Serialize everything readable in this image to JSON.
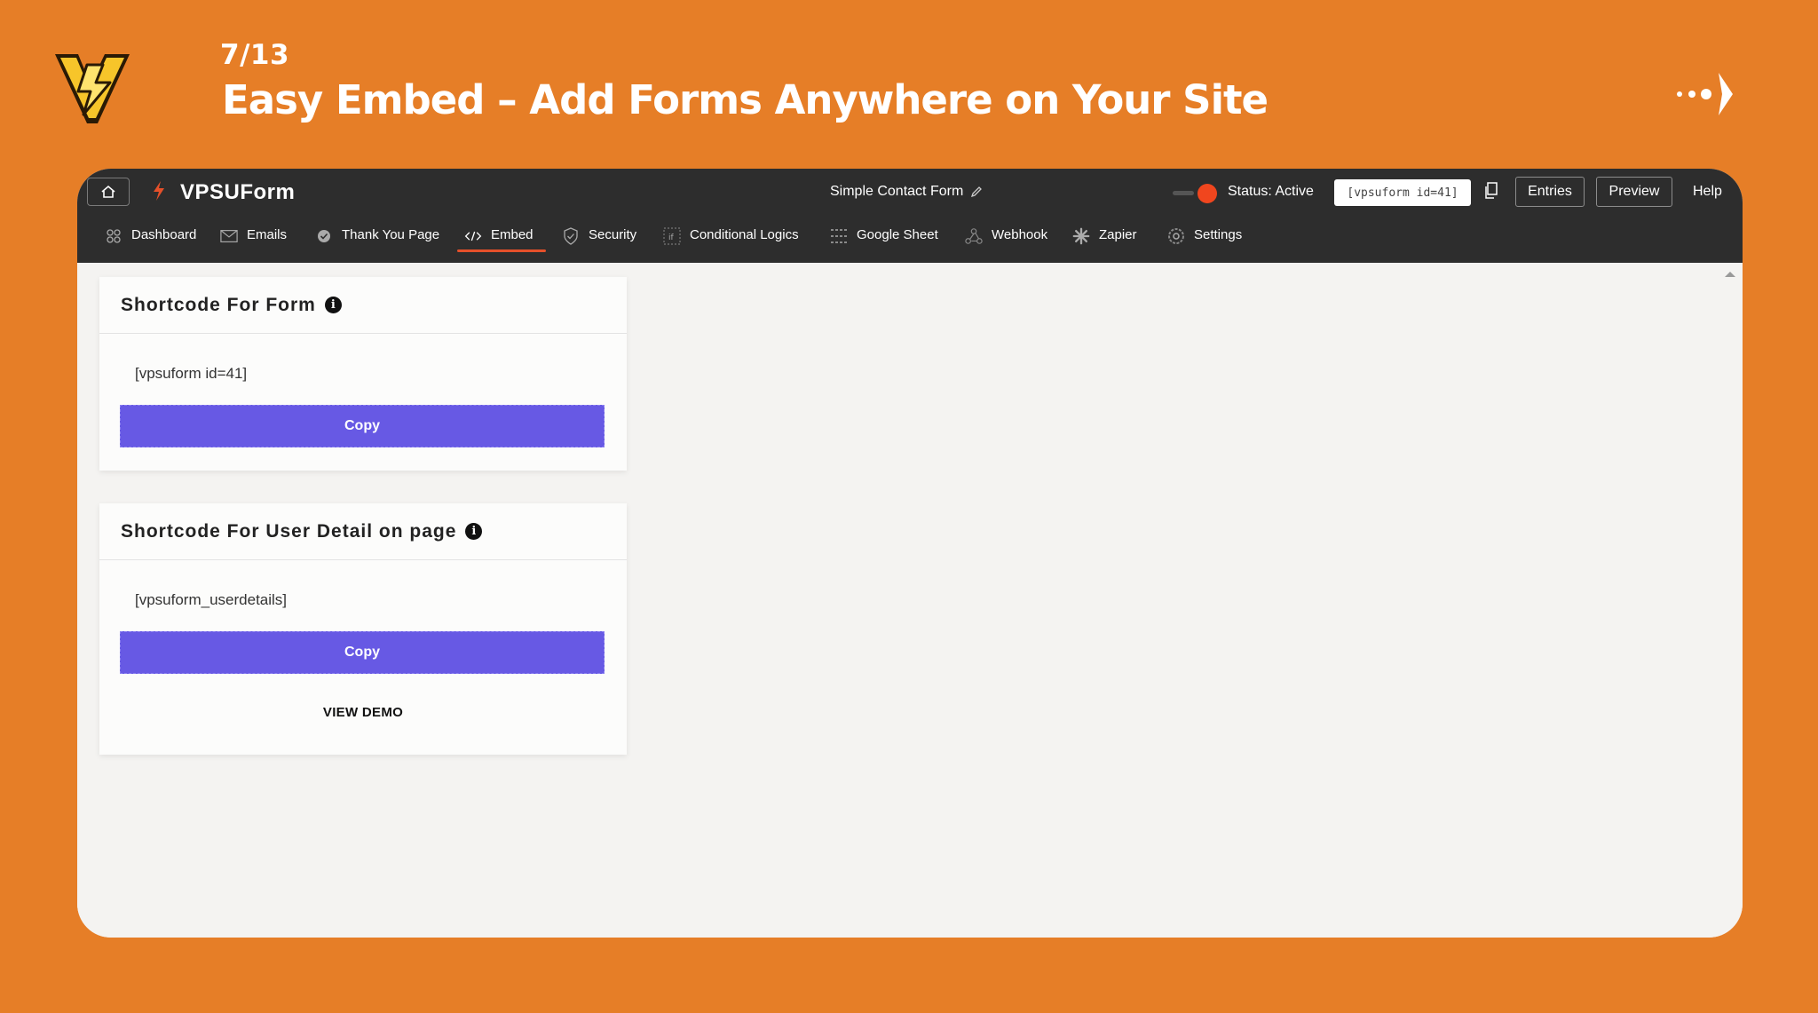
{
  "slide": {
    "counter": "7/13",
    "title": "Easy Embed – Add Forms Anywhere on Your Site"
  },
  "header": {
    "brand": "VPSUForm",
    "form_name": "Simple Contact Form",
    "status": "Status: Active",
    "shortcode_chip": "[vpsuform id=41]",
    "entries_label": "Entries",
    "preview_label": "Preview",
    "help_label": "Help"
  },
  "nav": {
    "items": [
      {
        "label": "Dashboard",
        "icon": "dashboard-icon"
      },
      {
        "label": "Emails",
        "icon": "mail-icon"
      },
      {
        "label": "Thank You Page",
        "icon": "check-badge-icon"
      },
      {
        "label": "Embed",
        "icon": "code-icon",
        "active": true
      },
      {
        "label": "Security",
        "icon": "shield-icon"
      },
      {
        "label": "Conditional Logics",
        "icon": "logic-icon"
      },
      {
        "label": "Google Sheet",
        "icon": "sheet-icon"
      },
      {
        "label": "Webhook",
        "icon": "webhook-icon"
      },
      {
        "label": "Zapier",
        "icon": "zapier-icon"
      },
      {
        "label": "Settings",
        "icon": "gear-icon"
      }
    ]
  },
  "cards": [
    {
      "title": "Shortcode For Form",
      "code": "[vpsuform id=41]",
      "copy_label": "Copy"
    },
    {
      "title": "Shortcode For User Detail on page",
      "code": "[vpsuform_userdetails]",
      "copy_label": "Copy",
      "link_label": "VIEW DEMO"
    }
  ],
  "colors": {
    "background": "#E67E27",
    "topbar": "#2D2D2D",
    "accent": "#6759E4",
    "status_dot": "#F0461E",
    "active_underline": "#E5502A"
  }
}
